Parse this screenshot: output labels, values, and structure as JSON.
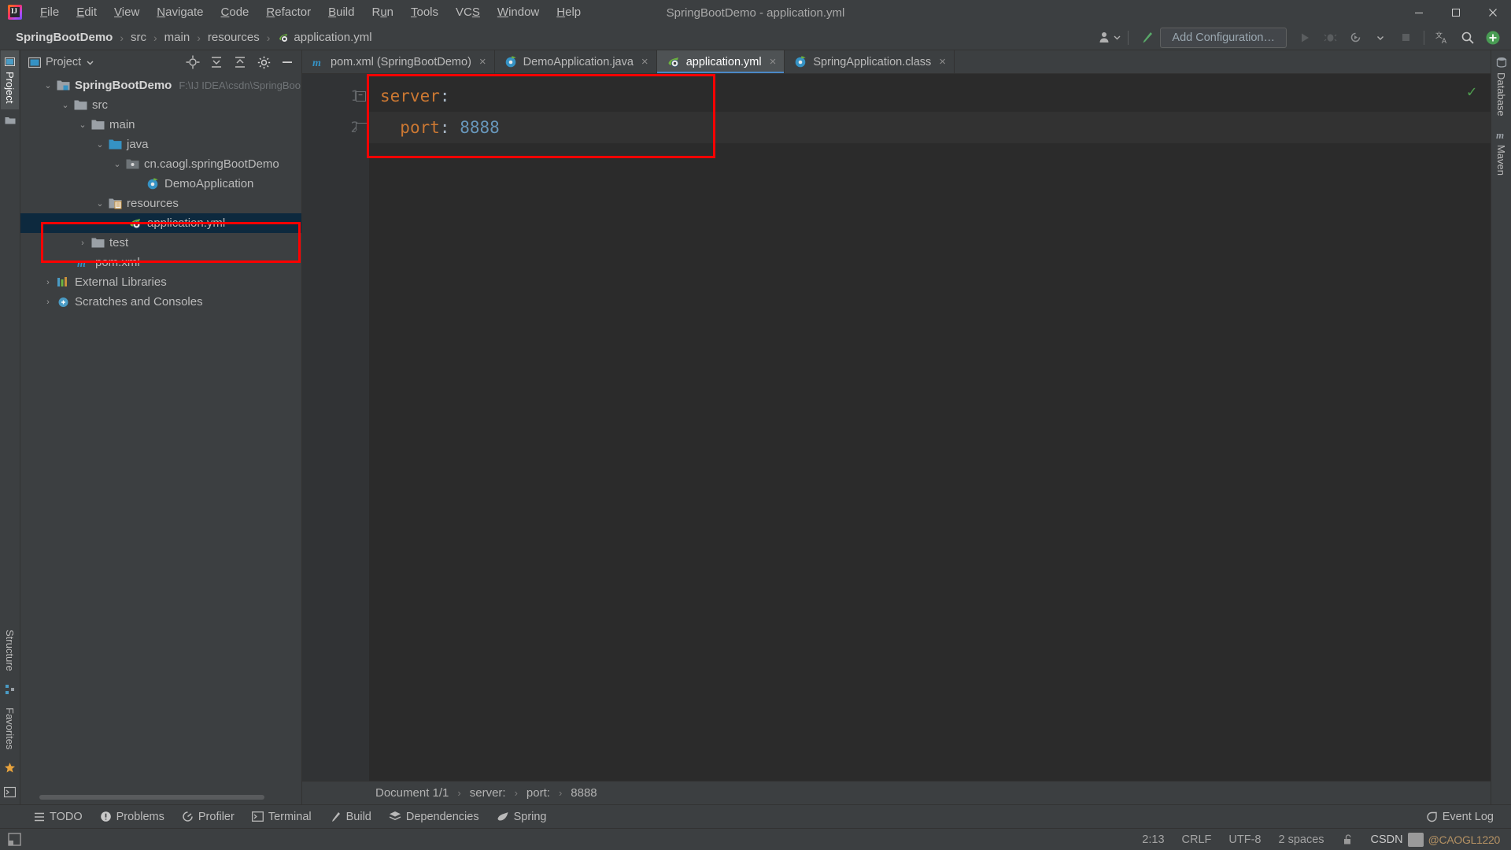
{
  "window": {
    "title": "SpringBootDemo - application.yml",
    "minimize_label": "─",
    "maximize_label": "☐",
    "close_label": "✕"
  },
  "menubar": {
    "items": [
      {
        "label": "File",
        "mnemonic": "F"
      },
      {
        "label": "Edit",
        "mnemonic": "E"
      },
      {
        "label": "View",
        "mnemonic": "V"
      },
      {
        "label": "Navigate",
        "mnemonic": "N"
      },
      {
        "label": "Code",
        "mnemonic": "C"
      },
      {
        "label": "Refactor",
        "mnemonic": "R"
      },
      {
        "label": "Build",
        "mnemonic": "B"
      },
      {
        "label": "Run",
        "mnemonic": "u"
      },
      {
        "label": "Tools",
        "mnemonic": "T"
      },
      {
        "label": "VCS",
        "mnemonic": "S"
      },
      {
        "label": "Window",
        "mnemonic": "W"
      },
      {
        "label": "Help",
        "mnemonic": "H"
      }
    ]
  },
  "navbar": {
    "crumbs": [
      {
        "label": "SpringBootDemo",
        "bold": true,
        "icon": ""
      },
      {
        "label": "src",
        "bold": false,
        "icon": ""
      },
      {
        "label": "main",
        "bold": false,
        "icon": ""
      },
      {
        "label": "resources",
        "bold": false,
        "icon": ""
      },
      {
        "label": "application.yml",
        "bold": false,
        "icon": "yml-file-icon"
      }
    ],
    "separator": "›",
    "add_configuration_label": "Add Configuration…",
    "icons": [
      "user-avatar-icon",
      "chevron-down-icon",
      "build-hammer-icon",
      "run-icon",
      "debug-icon",
      "run-coverage-icon",
      "more-chevron-icon",
      "stop-icon",
      "translate-icon",
      "search-icon",
      "plus-icon"
    ]
  },
  "left_stripe": {
    "tabs": [
      {
        "label": "Project",
        "selected": true,
        "icon": "project-icon"
      },
      {
        "label": "Structure",
        "selected": false,
        "icon": "structure-icon"
      },
      {
        "label": "Favorites",
        "selected": false,
        "icon": "star-icon"
      }
    ],
    "bottom_icon": "terminal-icon"
  },
  "right_stripe": {
    "tabs": [
      {
        "label": "Database",
        "icon": "database-icon"
      },
      {
        "label": "Maven",
        "icon": "maven-icon"
      }
    ]
  },
  "project_panel": {
    "title": "Project",
    "dropdown_icon": "chevron-down-icon",
    "toolbar_icons": [
      "locate-icon",
      "expand-all-icon",
      "collapse-all-icon",
      "settings-gear-icon",
      "hide-icon"
    ],
    "tree": [
      {
        "label": "SpringBootDemo",
        "path": "F:\\IJ IDEA\\csdn\\SpringBoo",
        "depth": 0,
        "twist": "⌄",
        "icon": "module-folder-icon",
        "bold": true,
        "selected": false
      },
      {
        "label": "src",
        "path": "",
        "depth": 1,
        "twist": "⌄",
        "icon": "folder-icon",
        "bold": false,
        "selected": false
      },
      {
        "label": "main",
        "path": "",
        "depth": 2,
        "twist": "⌄",
        "icon": "folder-icon",
        "bold": false,
        "selected": false
      },
      {
        "label": "java",
        "path": "",
        "depth": 3,
        "twist": "⌄",
        "icon": "source-folder-icon",
        "bold": false,
        "selected": false
      },
      {
        "label": "cn.caogl.springBootDemo",
        "path": "",
        "depth": 4,
        "twist": "⌄",
        "icon": "package-icon",
        "bold": false,
        "selected": false
      },
      {
        "label": "DemoApplication",
        "path": "",
        "depth": 5,
        "twist": "",
        "icon": "spring-class-icon",
        "bold": false,
        "selected": false
      },
      {
        "label": "resources",
        "path": "",
        "depth": 3,
        "twist": "⌄",
        "icon": "resources-folder-icon",
        "bold": false,
        "selected": false
      },
      {
        "label": "application.yml",
        "path": "",
        "depth": 4,
        "twist": "",
        "icon": "spring-yml-icon",
        "bold": false,
        "selected": true
      },
      {
        "label": "test",
        "path": "",
        "depth": 2,
        "twist": "›",
        "icon": "folder-icon",
        "bold": false,
        "selected": false
      },
      {
        "label": "pom.xml",
        "path": "",
        "depth": 1,
        "twist": "",
        "icon": "maven-m-icon",
        "bold": false,
        "selected": false
      },
      {
        "label": "External Libraries",
        "path": "",
        "depth": 0,
        "twist": "›",
        "icon": "libraries-icon",
        "bold": false,
        "selected": false
      },
      {
        "label": "Scratches and Consoles",
        "path": "",
        "depth": 0,
        "twist": "›",
        "icon": "scratches-icon",
        "bold": false,
        "selected": false
      }
    ]
  },
  "editor_tabs": [
    {
      "label": "pom.xml (SpringBootDemo)",
      "icon": "maven-m-icon",
      "active": false,
      "close": "×"
    },
    {
      "label": "DemoApplication.java",
      "icon": "spring-class-icon",
      "active": false,
      "close": "×"
    },
    {
      "label": "application.yml",
      "icon": "spring-yml-icon",
      "active": true,
      "close": "×"
    },
    {
      "label": "SpringApplication.class",
      "icon": "spring-class-icon",
      "active": false,
      "close": "×"
    }
  ],
  "editor": {
    "line_numbers": [
      "1",
      "2"
    ],
    "lines": [
      {
        "key": "server",
        "colon": ":",
        "value": "",
        "indent": 0
      },
      {
        "key": "port",
        "colon": ":",
        "value": "8888",
        "indent": 2
      }
    ],
    "inspection_status": "✓",
    "breadcrumbs": [
      "Document 1/1",
      "server:",
      "port:",
      "8888"
    ],
    "breadcrumb_separator": "›"
  },
  "bottom_toolbar": {
    "items": [
      {
        "label": "TODO",
        "icon": "todo-icon"
      },
      {
        "label": "Problems",
        "icon": "problems-icon"
      },
      {
        "label": "Profiler",
        "icon": "profiler-icon"
      },
      {
        "label": "Terminal",
        "icon": "terminal-icon"
      },
      {
        "label": "Build",
        "icon": "build-hammer-icon"
      },
      {
        "label": "Dependencies",
        "icon": "dependencies-icon"
      },
      {
        "label": "Spring",
        "icon": "spring-leaf-icon"
      }
    ],
    "event_log_label": "Event Log",
    "event_log_icon": "event-log-icon"
  },
  "statusbar": {
    "caret_position": "2:13",
    "line_separator": "CRLF",
    "encoding": "UTF-8",
    "indent": "2 spaces",
    "lock_icon": "unlocked-icon",
    "watermark_brand": "CSDN",
    "watermark_text": "@CAOGL1220"
  },
  "colors": {
    "accent_blue": "#4a88c7",
    "yaml_key": "#cc7832",
    "yaml_value": "#6897bb",
    "highlight_red": "#ff0000",
    "selection_blue": "#0d293e",
    "panel_bg": "#3c3f41",
    "editor_bg": "#2b2b2b"
  }
}
